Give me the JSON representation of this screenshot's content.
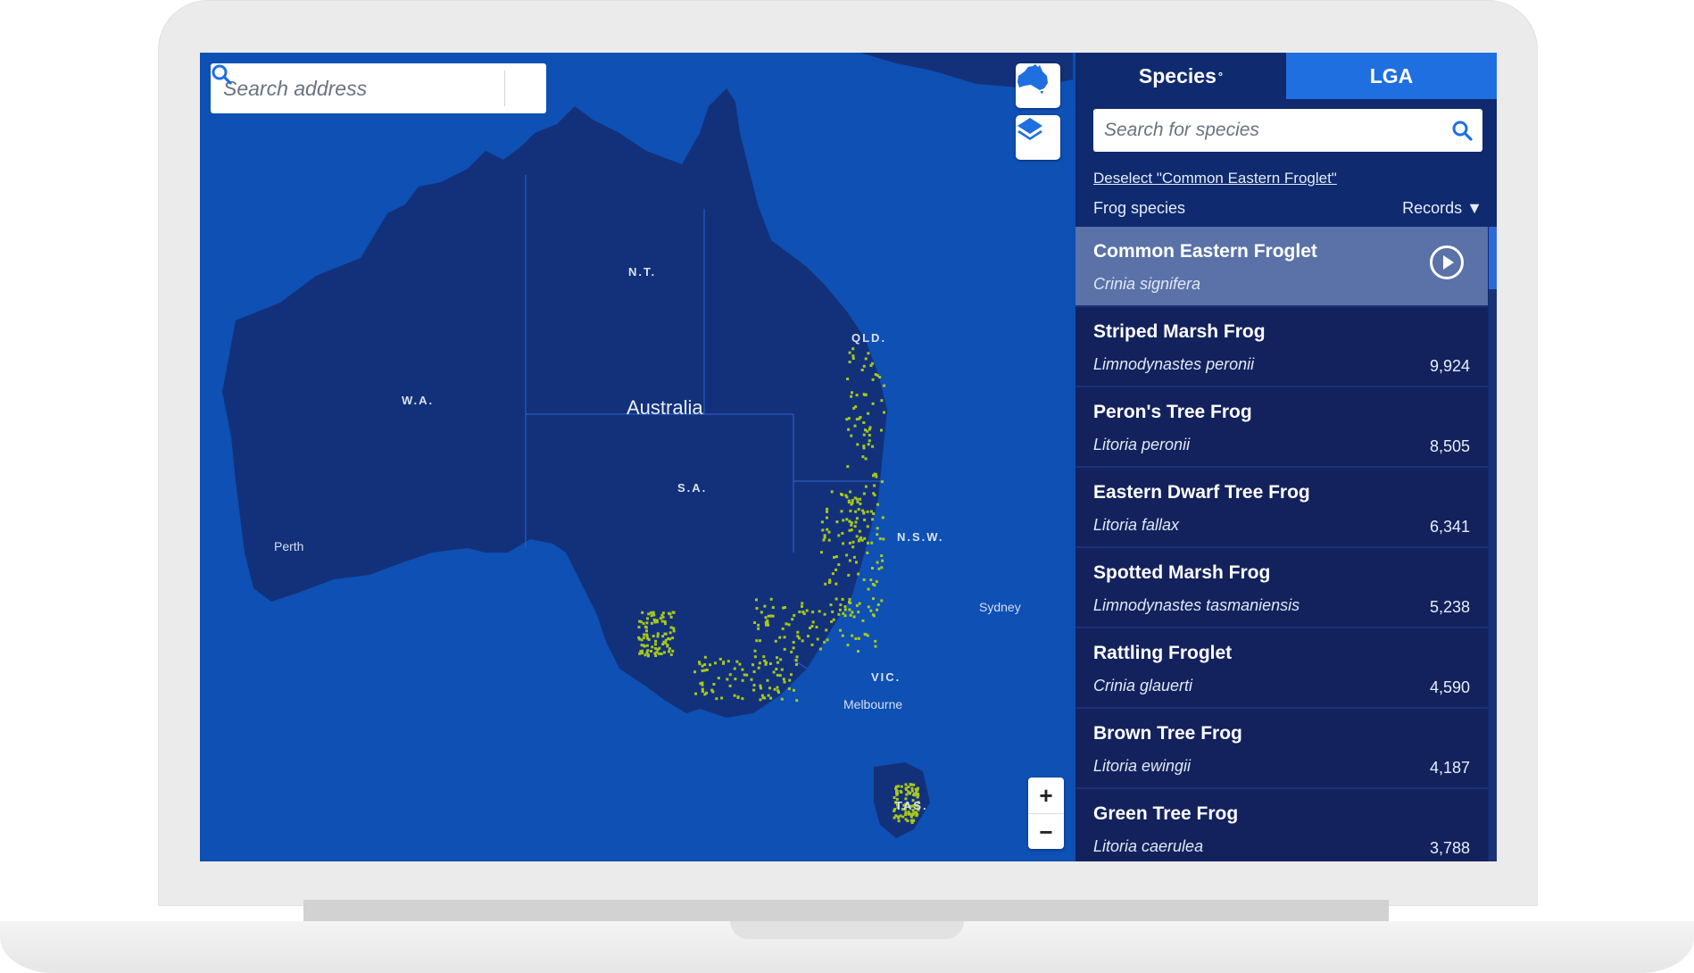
{
  "map": {
    "search_placeholder": "Search address",
    "labels": {
      "country": "Australia",
      "wa": "W.A.",
      "nt": "N.T.",
      "qld": "QLD.",
      "sa": "S.A.",
      "nsw": "N.S.W.",
      "vic": "VIC.",
      "tas": "TAS.",
      "perth": "Perth",
      "sydney": "Sydney",
      "melbourne": "Melbourne"
    },
    "zoom_in": "+",
    "zoom_out": "−",
    "colors": {
      "ocean": "#0e50b3",
      "land": "#13317a",
      "records": "#a8c81a"
    }
  },
  "panel": {
    "tabs": [
      {
        "label": "Species",
        "marker": "°",
        "active": true
      },
      {
        "label": "LGA",
        "active": false
      }
    ],
    "search_placeholder": "Search for species",
    "deselect_link": "Deselect \"Common Eastern Froglet\"",
    "list_title": "Frog species",
    "sort_label": "Records ▼",
    "species": [
      {
        "name": "Common Eastern Froglet",
        "scientific": "Crinia signifera",
        "count": "",
        "selected": true
      },
      {
        "name": "Striped Marsh Frog",
        "scientific": "Limnodynastes peronii",
        "count": "9,924"
      },
      {
        "name": "Peron's Tree Frog",
        "scientific": "Litoria peronii",
        "count": "8,505"
      },
      {
        "name": "Eastern Dwarf Tree Frog",
        "scientific": "Litoria fallax",
        "count": "6,341"
      },
      {
        "name": "Spotted Marsh Frog",
        "scientific": "Limnodynastes tasmaniensis",
        "count": "5,238"
      },
      {
        "name": "Rattling Froglet",
        "scientific": "Crinia glauerti",
        "count": "4,590"
      },
      {
        "name": "Brown Tree Frog",
        "scientific": "Litoria ewingii",
        "count": "4,187"
      },
      {
        "name": "Green Tree Frog",
        "scientific": "Litoria caerulea",
        "count": "3,788"
      }
    ],
    "colors": {
      "panel": "#0f2a6e",
      "active_tab": "#1f6fe0",
      "selected_row": "#5a72a8"
    }
  }
}
